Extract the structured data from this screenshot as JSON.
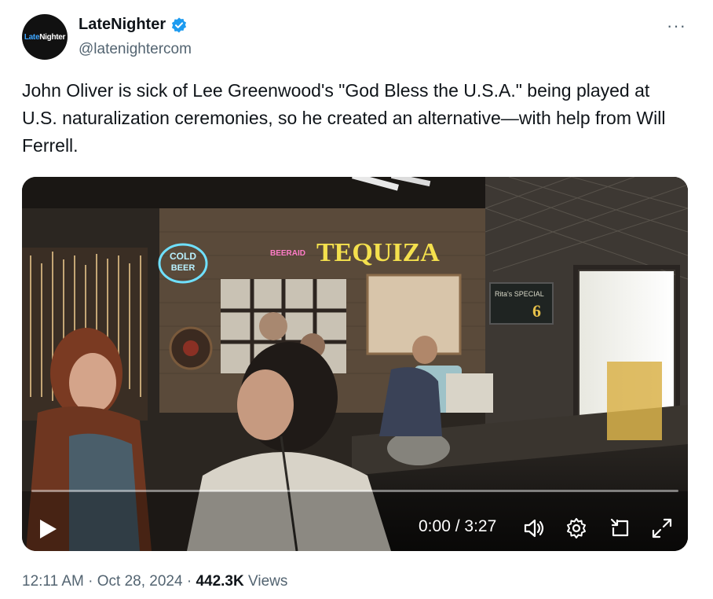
{
  "author": {
    "display_name": "LateNighter",
    "handle": "@latenightercom",
    "avatar_text_a": "Late",
    "avatar_text_b": "Nighter",
    "avatar_bg": "#111111",
    "verified_color": "#1d9bf0"
  },
  "more_icon": "···",
  "tweet": {
    "text": "John Oliver is sick of Lee Greenwood's \"God Bless the U.S.A.\" being played at U.S. naturalization ceremonies, so he created an alternative—with help from Will Ferrell."
  },
  "video": {
    "current_time": "0:00",
    "separator": "/",
    "duration": "3:27",
    "progress": 0,
    "icons": [
      "play-icon",
      "volume-icon",
      "settings-icon",
      "picture-in-picture-icon",
      "fullscreen-icon"
    ],
    "signs": {
      "cold_beer_a": "COLD",
      "cold_beer_b": "BEER",
      "neon_main": "TEQUIZA",
      "small_neon": "BEERAID",
      "special_a": "Rita's SPECIAL",
      "special_price": "6"
    }
  },
  "meta": {
    "time": "12:11 AM",
    "dot1": "·",
    "date": "Oct 28, 2024",
    "dot2": "·",
    "views_count": "442.3K",
    "views_label": "Views"
  }
}
